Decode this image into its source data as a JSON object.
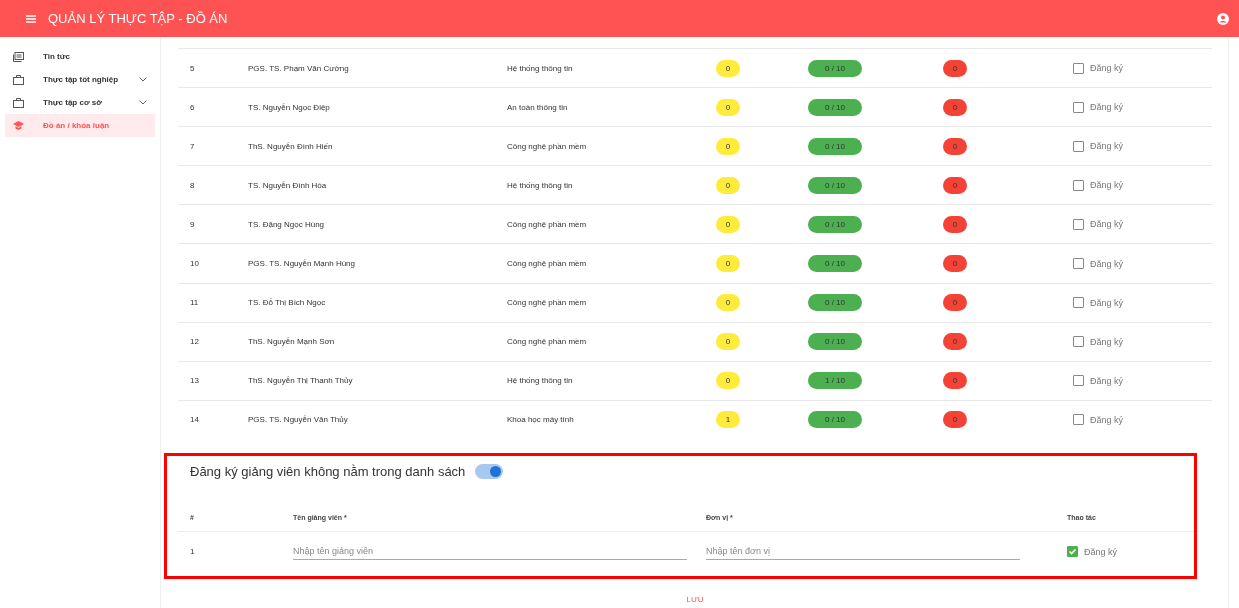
{
  "header": {
    "title": "QUẢN LÝ THỰC TẬP - ĐỒ ÁN"
  },
  "sidebar": {
    "items": [
      {
        "label": "Tin tức",
        "expandable": false,
        "selected": false
      },
      {
        "label": "Thực tập tốt nghiệp",
        "expandable": true,
        "selected": false
      },
      {
        "label": "Thực tập cơ sở",
        "expandable": true,
        "selected": false
      },
      {
        "label": "Đồ án / khóa luận",
        "expandable": false,
        "selected": true
      }
    ]
  },
  "table": {
    "rows": [
      {
        "number": "5",
        "lecturer": "PGS. TS. Phạm Văn Cường",
        "department": "Hệ thống thông tin",
        "count_1": "0",
        "count_2": "0 / 10",
        "count_3": "0",
        "action": "Đăng ký",
        "checked": false
      },
      {
        "number": "6",
        "lecturer": "TS. Nguyễn Ngọc Điệp",
        "department": "An toàn thông tin",
        "count_1": "0",
        "count_2": "0 / 10",
        "count_3": "0",
        "action": "Đăng ký",
        "checked": false
      },
      {
        "number": "7",
        "lecturer": "ThS. Nguyễn Đình Hiến",
        "department": "Công nghệ phần mềm",
        "count_1": "0",
        "count_2": "0 / 10",
        "count_3": "0",
        "action": "Đăng ký",
        "checked": false
      },
      {
        "number": "8",
        "lecturer": "TS. Nguyễn Đình Hóa",
        "department": "Hệ thống thông tin",
        "count_1": "0",
        "count_2": "0 / 10",
        "count_3": "0",
        "action": "Đăng ký",
        "checked": false
      },
      {
        "number": "9",
        "lecturer": "TS. Đặng Ngọc Hùng",
        "department": "Công nghệ phần mềm",
        "count_1": "0",
        "count_2": "0 / 10",
        "count_3": "0",
        "action": "Đăng ký",
        "checked": false
      },
      {
        "number": "10",
        "lecturer": "PGS. TS. Nguyễn Mạnh Hùng",
        "department": "Công nghệ phần mềm",
        "count_1": "0",
        "count_2": "0 / 10",
        "count_3": "0",
        "action": "Đăng ký",
        "checked": false
      },
      {
        "number": "11",
        "lecturer": "TS. Đỗ Thị Bích Ngọc",
        "department": "Công nghệ phần mềm",
        "count_1": "0",
        "count_2": "0 / 10",
        "count_3": "0",
        "action": "Đăng ký",
        "checked": false
      },
      {
        "number": "12",
        "lecturer": "ThS. Nguyễn Mạnh Sơn",
        "department": "Công nghệ phần mềm",
        "count_1": "0",
        "count_2": "0 / 10",
        "count_3": "0",
        "action": "Đăng ký",
        "checked": false
      },
      {
        "number": "13",
        "lecturer": "ThS. Nguyễn Thị Thanh Thủy",
        "department": "Hệ thống thông tin",
        "count_1": "0",
        "count_2": "1 / 10",
        "count_3": "0",
        "action": "Đăng ký",
        "checked": false
      },
      {
        "number": "14",
        "lecturer": "PGS. TS. Nguyễn Văn Thủy",
        "department": "Khoa học máy tính",
        "count_1": "1",
        "count_2": "0 / 10",
        "count_3": "0",
        "action": "Đăng ký",
        "checked": false
      }
    ]
  },
  "other_lecturer": {
    "title": "Đăng ký giảng viên không nằm trong danh sách",
    "toggle_on": true,
    "columns": [
      "#",
      "Tên giảng viên *",
      "Đơn vị *",
      "Thao tác"
    ],
    "rows": [
      {
        "number": "1",
        "name_placeholder": "Nhập tên giảng viên",
        "unit_placeholder": "Nhập tên đơn vị",
        "action": "Đăng ký",
        "checked": true
      }
    ]
  },
  "save_button": "LƯU"
}
